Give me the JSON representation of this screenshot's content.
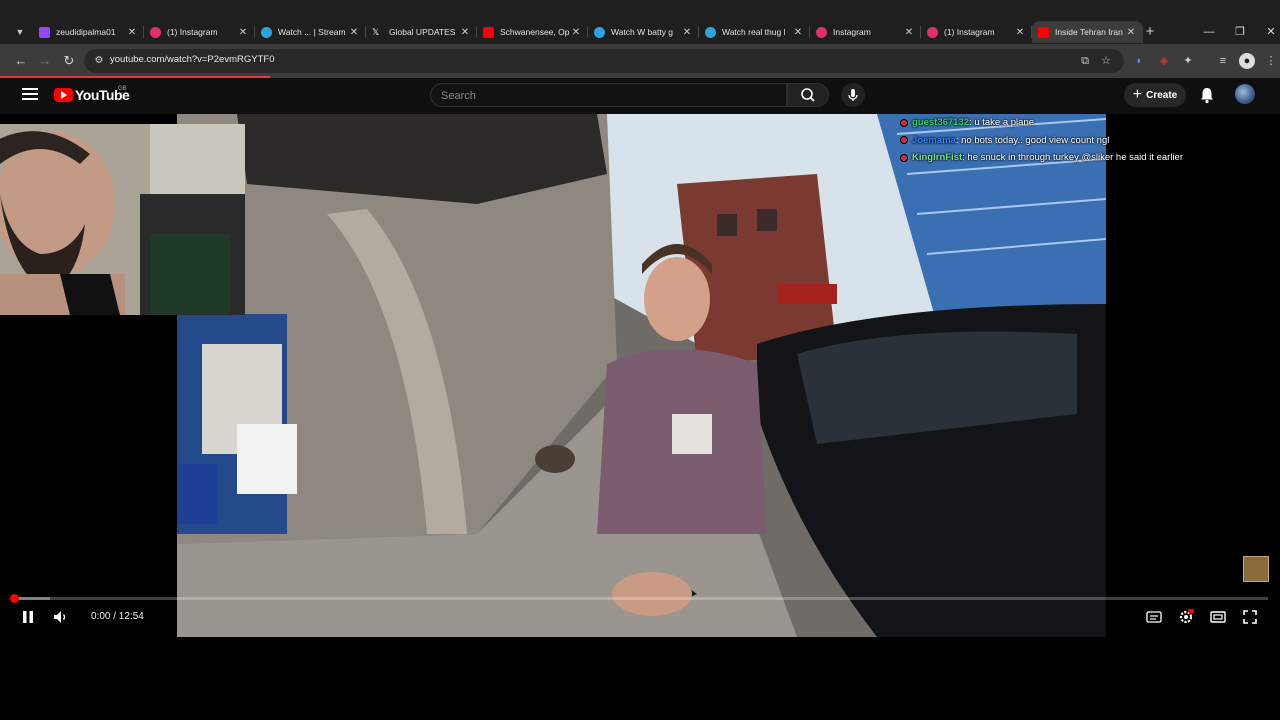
{
  "browser": {
    "tabs": [
      {
        "title": "zeudidipalma01",
        "favicon": "twitch-icon",
        "color": "#9146ff",
        "active": false
      },
      {
        "title": "(1) Instagram",
        "favicon": "instagram-icon",
        "color": "#e1306c",
        "active": false
      },
      {
        "title": "Watch ... | Stream",
        "favicon": "globe-icon",
        "color": "#2aa5e0",
        "active": false
      },
      {
        "title": "Global UPDATES",
        "favicon": "x-icon",
        "color": "#ffffff",
        "active": false
      },
      {
        "title": "Schwanensee, Op",
        "favicon": "youtube-icon",
        "color": "#ff0000",
        "active": false
      },
      {
        "title": "Watch W batty g",
        "favicon": "globe-icon",
        "color": "#2aa5e0",
        "active": false
      },
      {
        "title": "Watch real thug l",
        "favicon": "globe-icon",
        "color": "#2aa5e0",
        "active": false
      },
      {
        "title": "Instagram",
        "favicon": "instagram-icon",
        "color": "#e1306c",
        "active": false
      },
      {
        "title": "(1) Instagram",
        "favicon": "instagram-icon",
        "color": "#e1306c",
        "active": false
      },
      {
        "title": "Inside Tehran Iran",
        "favicon": "youtube-icon",
        "color": "#ff0000",
        "active": true
      }
    ],
    "url": "youtube.com/watch?v=P2evmRGYTF0"
  },
  "youtube": {
    "logo_text": "YouTube",
    "region": "GB",
    "search_placeholder": "Search",
    "create_label": "Create"
  },
  "chat": [
    {
      "user": "guest367132",
      "message": ": u take a plane",
      "user_color": "#2ecc71"
    },
    {
      "user": "Joemama",
      "message": ": no bots today.. good view count ngl",
      "user_color": "#3b82f6"
    },
    {
      "user": "KingIrnFist",
      "message": ": he snuck in through turkey @sliker he said it earlier",
      "user_color": "#7be37b"
    }
  ],
  "player": {
    "current_time": "0:00",
    "duration": "12:54",
    "time_display": "0:00 / 12:54",
    "progress_fraction": 0.0,
    "buffered_fraction": 0.03,
    "accent_color": "#ff0000"
  }
}
